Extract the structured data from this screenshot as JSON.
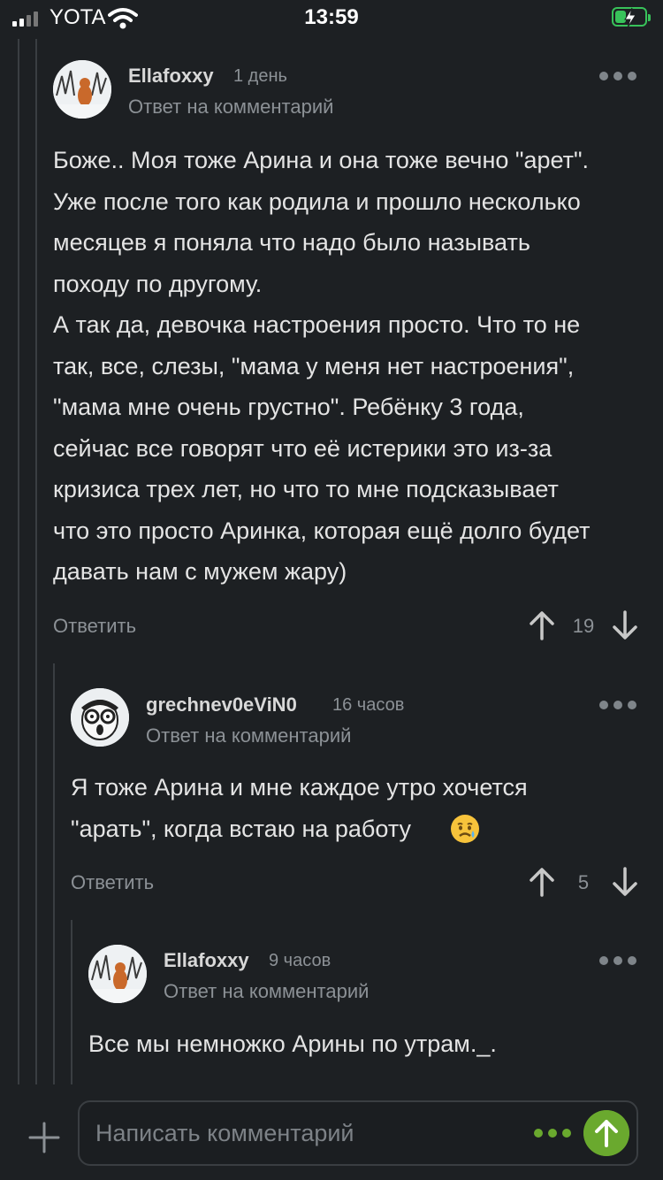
{
  "status_bar": {
    "carrier": "YOTA",
    "time": "13:59",
    "battery_color": "#38c25a"
  },
  "comments": [
    {
      "author": "Ellafoxxy",
      "age": "1 день",
      "subtitle": "Ответ на комментарий",
      "text": "Боже.. Моя тоже Арина и она тоже вечно \"арет\".\nУже после того как родила и прошло несколько\nмесяцев я поняла что надо было называть\nпоходу по другому.\nА так да, девочка настроения просто. Что то не\nтак, все, слезы, \"мама у меня нет настроения\",\n\"мама мне очень грустно\". Ребёнку 3 года,\nсейчас все говорят что её истерики это из-за\nкризиса трех лет, но что то мне подсказывает\nчто это просто Аринка, которая ещё долго будет\nдавать нам с мужем жару)",
      "reply_label": "Ответить",
      "score": "19"
    },
    {
      "author": "grechnev0eViN0",
      "age": "16 часов",
      "subtitle": "Ответ на комментарий",
      "text": "Я тоже Арина и мне каждое утро хочется\n\"арать\", когда встаю на работу",
      "reply_label": "Ответить",
      "score": "5"
    },
    {
      "author": "Ellafoxxy",
      "age": "9 часов",
      "subtitle": "Ответ на комментарий",
      "text": "Все мы немножко Арины по утрам._."
    }
  ],
  "composer": {
    "placeholder": "Написать комментарий"
  },
  "colors": {
    "background": "#1d2023",
    "accent": "#6aa92e"
  }
}
